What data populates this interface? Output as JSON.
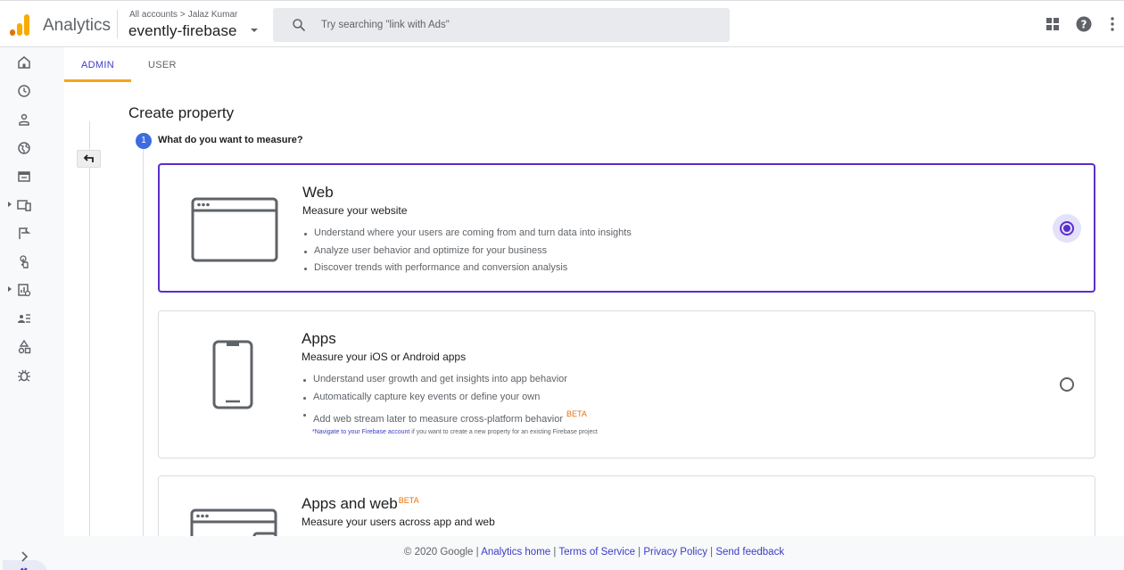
{
  "header": {
    "app_title": "Analytics",
    "breadcrumb": {
      "all_accounts": "All accounts",
      "separator": ">",
      "account": "Jalaz Kumar"
    },
    "property": "evently-firebase",
    "search_placeholder": "Try searching \"link with Ads\"",
    "icons": [
      "apps-grid-icon",
      "help-icon",
      "more-vert-icon"
    ]
  },
  "nav": {
    "items": [
      "home-icon",
      "realtime-clock-icon",
      "audience-person-icon",
      "acquisition-globe-icon",
      "behavior-page-icon",
      "devices-icon",
      "conversions-flag-icon",
      "touch-icon",
      "reports-icon",
      "user-list-icon",
      "shapes-icon",
      "debug-bug-icon",
      "admin-gear-icon",
      "expand-chevron-icon"
    ]
  },
  "tabs": [
    {
      "label": "ADMIN",
      "active": true
    },
    {
      "label": "USER",
      "active": false
    }
  ],
  "page": {
    "title": "Create property",
    "step_number": "1",
    "step_question": "What do you want to measure?"
  },
  "options": {
    "web": {
      "title": "Web",
      "subtitle": "Measure your website",
      "bullets": [
        "Understand where your users are coming from and turn data into insights",
        "Analyze user behavior and optimize for your business",
        "Discover trends with performance and conversion analysis"
      ],
      "selected": true
    },
    "apps": {
      "title": "Apps",
      "subtitle": "Measure your iOS or Android apps",
      "bullets": [
        "Understand user growth and get insights into app behavior",
        "Automatically capture key events or define your own",
        "Add web stream later to measure cross-platform behavior"
      ],
      "beta": "BETA",
      "note_link": "*Navigate to your Firebase account",
      "note_text": " if you want to create a new property for an existing Firebase project",
      "selected": false
    },
    "apps_web": {
      "title": "Apps and web",
      "beta": "BETA",
      "subtitle": "Measure your users across app and web"
    }
  },
  "footer": {
    "copyright": "© 2020 Google",
    "sep": " | ",
    "links": [
      "Analytics home",
      "Terms of Service",
      "Privacy Policy",
      "Send feedback"
    ]
  },
  "colors": {
    "accent_purple": "#5b2fc9",
    "link_blue": "#3c3cc6",
    "tab_underline": "#f4a51c",
    "beta_orange": "#e8710a",
    "step_blue": "#3d6be0"
  }
}
